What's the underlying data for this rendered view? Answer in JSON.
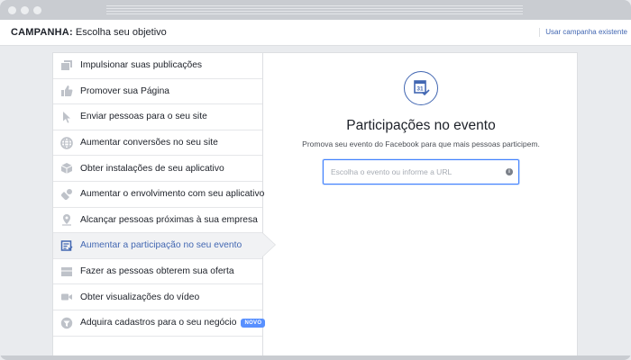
{
  "header": {
    "title_bold": "CAMPANHA:",
    "title_rest": " Escolha seu objetivo",
    "link": "Usar campanha existente"
  },
  "menu": {
    "items": [
      {
        "label": "Impulsionar suas publicações",
        "icon": "boost-post-icon"
      },
      {
        "label": "Promover sua Página",
        "icon": "thumbs-up-icon"
      },
      {
        "label": "Enviar pessoas para o seu site",
        "icon": "cursor-icon"
      },
      {
        "label": "Aumentar conversões no seu site",
        "icon": "globe-icon"
      },
      {
        "label": "Obter instalações de seu aplicativo",
        "icon": "box-icon"
      },
      {
        "label": "Aumentar o envolvimento com seu aplicativo",
        "icon": "gamepad-icon"
      },
      {
        "label": "Alcançar pessoas próximas à sua empresa",
        "icon": "map-pin-icon"
      },
      {
        "label": "Aumentar a participação no seu evento",
        "icon": "calendar-icon",
        "active": true
      },
      {
        "label": "Fazer as pessoas obterem sua oferta",
        "icon": "offer-icon"
      },
      {
        "label": "Obter visualizações do vídeo",
        "icon": "video-icon"
      },
      {
        "label": "Adquira cadastros para o seu negócio",
        "icon": "filter-icon",
        "badge": "NOVO"
      }
    ]
  },
  "content": {
    "title": "Participações no evento",
    "description": "Promova seu evento do Facebook para que mais pessoas participem.",
    "input_placeholder": "Escolha o evento ou informe a URL",
    "input_value": "",
    "info": "i"
  },
  "colors": {
    "accent": "#4267b2",
    "focus": "#4080ff",
    "badge": "#5890ff",
    "icon_gray": "#bec2c9"
  }
}
